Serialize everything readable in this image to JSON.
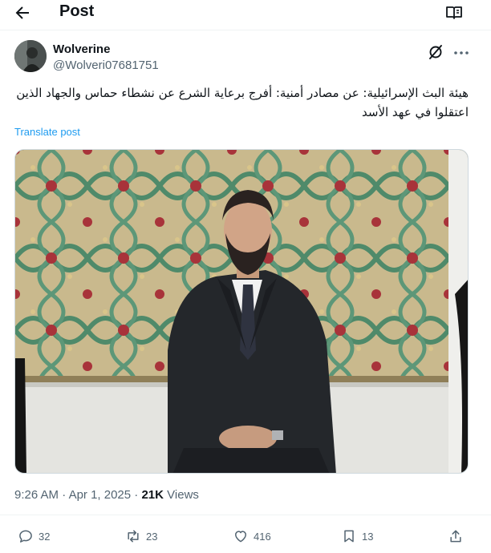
{
  "header": {
    "title": "Post",
    "back_icon": "arrow-left-icon",
    "reader_icon": "book-open-icon"
  },
  "author": {
    "display_name": "Wolverine",
    "handle": "@Wolveri07681751"
  },
  "post": {
    "text": "هيئة البث الإسرائيلية:  عن مصادر أمنية: أفرج برعاية الشرع عن نشطاء حماس والجهاد الذين اعتقلوا في عهد الأسد",
    "translate_label": "Translate post",
    "time": "9:26 AM",
    "separator": "·",
    "date": "Apr 1, 2025",
    "separator2": "·",
    "views_count": "21K",
    "views_label": "Views"
  },
  "actions": {
    "replies": "32",
    "reposts": "23",
    "likes": "416",
    "bookmarks": "13"
  },
  "colors": {
    "accent": "#1d9bf0",
    "muted": "#536471",
    "text": "#0f1419",
    "border": "#eff3f4"
  }
}
